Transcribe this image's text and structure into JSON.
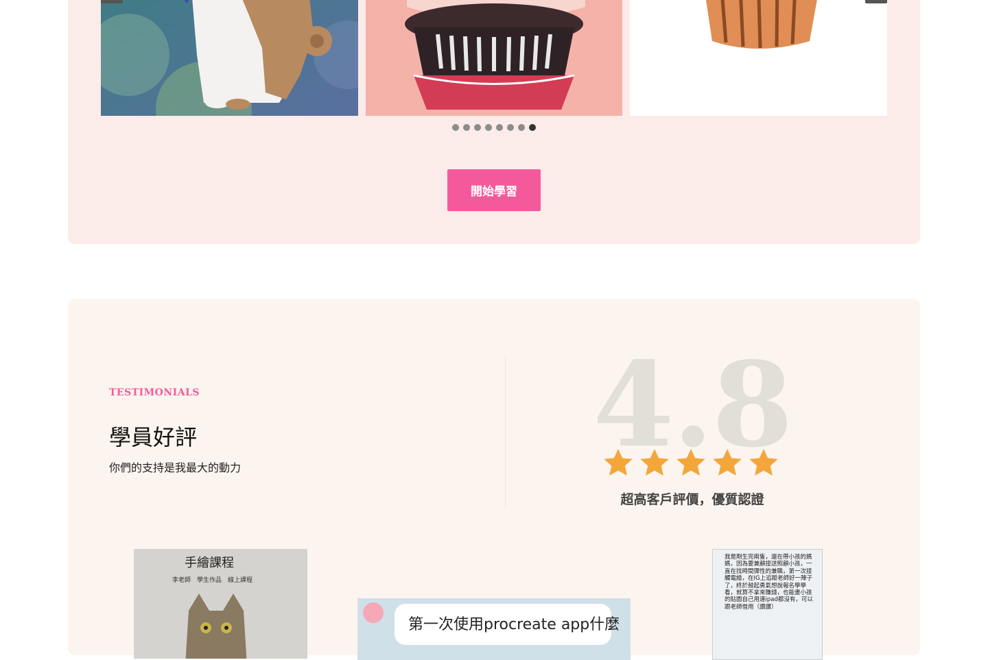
{
  "gallery": {
    "tiles": [
      {
        "name": "dog-illustration"
      },
      {
        "name": "cupcake-illustration"
      },
      {
        "name": "cupcake-sketch-illustration"
      }
    ],
    "dots_total": 8,
    "active_dot": 8,
    "cta_label": "開始學習",
    "colors": {
      "section_bg": "#fbebe9",
      "cta_bg": "#f45a9b"
    }
  },
  "testimonials": {
    "eyebrow": "TESTIMONIALS",
    "title": "學員好評",
    "subtitle": "你們的支持是我最大的動力",
    "score": "4.8",
    "stars": 5,
    "rating_caption": "超高客戶評價，優質認證",
    "reviews": [
      {
        "heading": "手繪課程",
        "labels": "李老師　學生作品　線上課程"
      },
      {
        "text": "第一次使用procreate app什麼"
      },
      {
        "text": "我是剛生完兩隻，還在帶小孩的媽媽，因為要兼顧接送照顧小孩，一直在找時間彈性的兼職，第一次接觸電繪，在IG上追蹤老師好一陣子了，終於鼓起勇氣想說報名學學看，就算不拿來賺錢，也能畫小孩的貼圖自己用連ipad都沒有，可以跟老師借用（讚讚）"
      }
    ],
    "colors": {
      "section_bg": "#fcf5ef",
      "eyebrow": "#f45a9b",
      "star": "#f3a73b"
    }
  }
}
